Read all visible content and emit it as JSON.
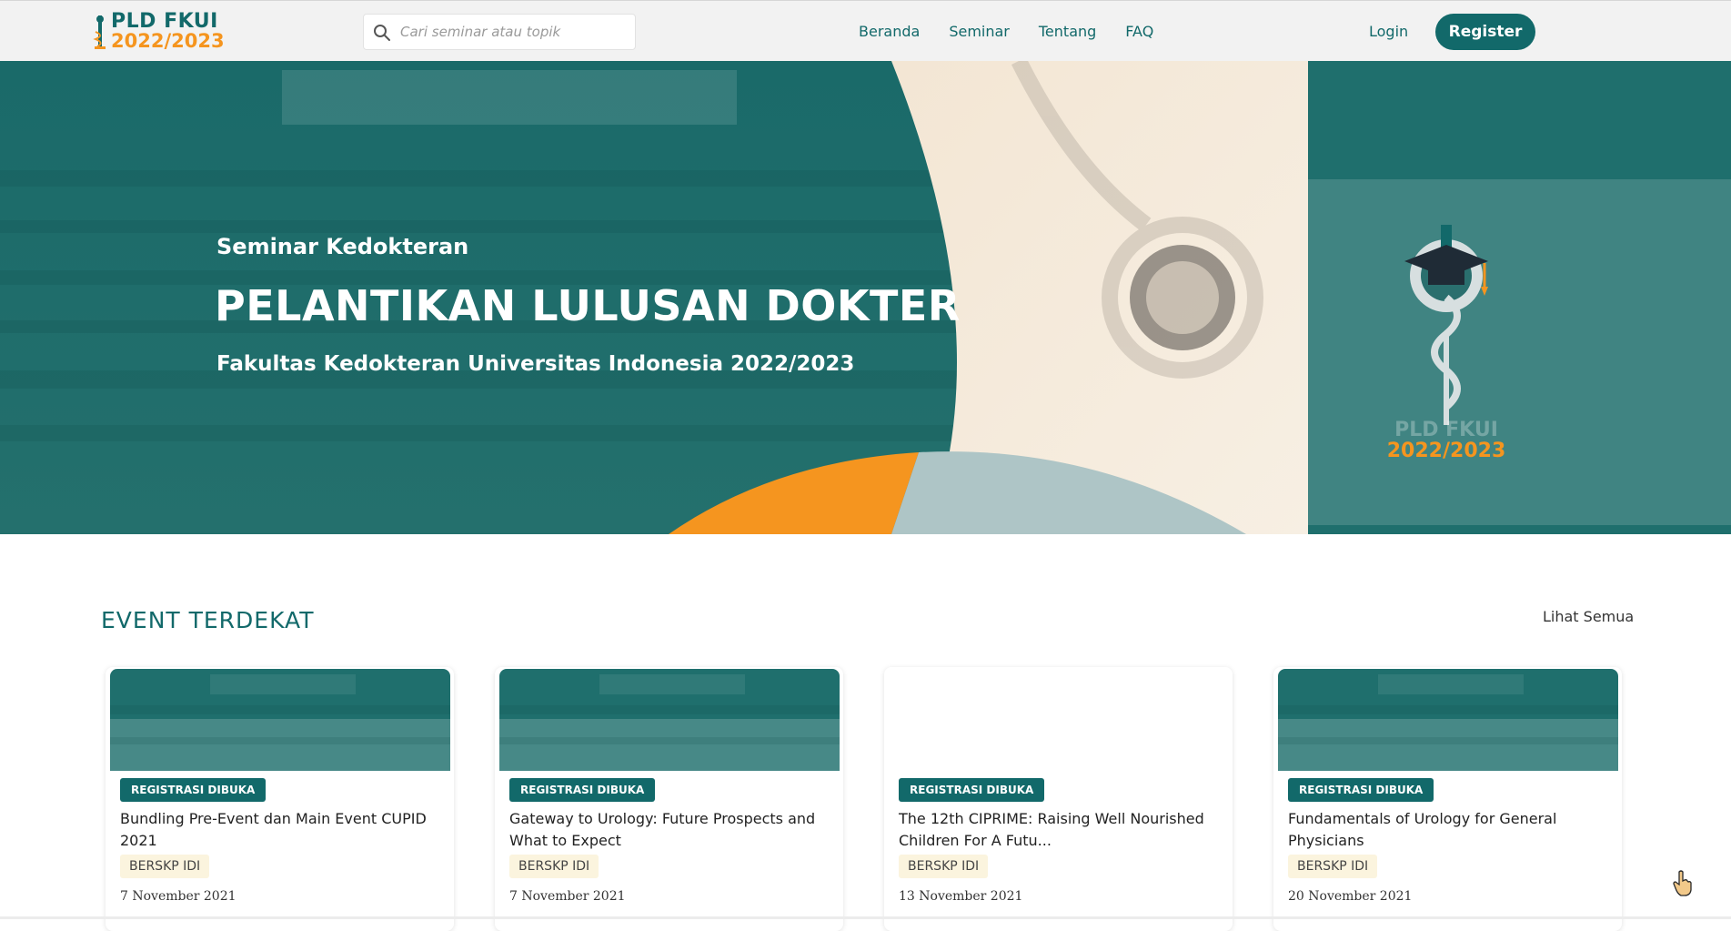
{
  "brand": {
    "line1": "PLD FKUI",
    "line2": "2022/2023",
    "primary_color": "#12696a",
    "accent_color": "#f5951f"
  },
  "search": {
    "placeholder": "Cari seminar atau topik",
    "icon": "search-icon"
  },
  "nav": {
    "links": [
      "Beranda",
      "Seminar",
      "Tentang",
      "FAQ"
    ]
  },
  "auth": {
    "login_label": "Login",
    "register_label": "Register"
  },
  "hero": {
    "subtitle": "Seminar Kedokteran",
    "title": "PELANTIKAN LULUSAN DOKTER",
    "faculty": "Fakultas Kedokteran Universitas Indonesia 2022/2023",
    "badge_line1": "PLD FKUI",
    "badge_line2": "2022/2023"
  },
  "events": {
    "section_title": "EVENT TERDEKAT",
    "see_all_label": "Lihat Semua",
    "cards": [
      {
        "status": "REGISTRASI DIBUKA",
        "title": "Bundling Pre-Event dan Main Event CUPID 2021",
        "tag": "BERSKP IDI",
        "date": "7 November 2021",
        "has_image": true
      },
      {
        "status": "REGISTRASI DIBUKA",
        "title": "Gateway to Urology: Future Prospects and What to Expect",
        "tag": "BERSKP IDI",
        "date": "7 November 2021",
        "has_image": true
      },
      {
        "status": "REGISTRASI DIBUKA",
        "title": "The 12th CIPRIME: Raising Well Nourished Children For A Futu...",
        "tag": "BERSKP IDI",
        "date": "13 November 2021",
        "has_image": false
      },
      {
        "status": "REGISTRASI DIBUKA",
        "title": "Fundamentals of Urology for General Physicians",
        "tag": "BERSKP IDI",
        "date": "20 November 2021",
        "has_image": true
      }
    ]
  }
}
